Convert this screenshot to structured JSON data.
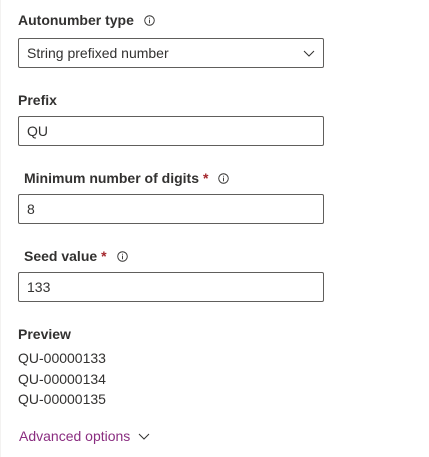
{
  "autonumber": {
    "label": "Autonumber type",
    "info_icon": "info-icon",
    "value": "String prefixed number",
    "chevron_icon": "chevron-down-icon"
  },
  "prefix": {
    "label": "Prefix",
    "value": "QU"
  },
  "min_digits": {
    "label": "Minimum number of digits",
    "required_mark": "*",
    "value": "8"
  },
  "seed": {
    "label": "Seed value",
    "required_mark": "*",
    "value": "133"
  },
  "preview": {
    "label": "Preview",
    "items": [
      "QU-00000133",
      "QU-00000134",
      "QU-00000135"
    ]
  },
  "advanced": {
    "label": "Advanced options"
  },
  "colors": {
    "required": "#a4262c",
    "link": "#8a2d80",
    "border": "#605e5c"
  }
}
